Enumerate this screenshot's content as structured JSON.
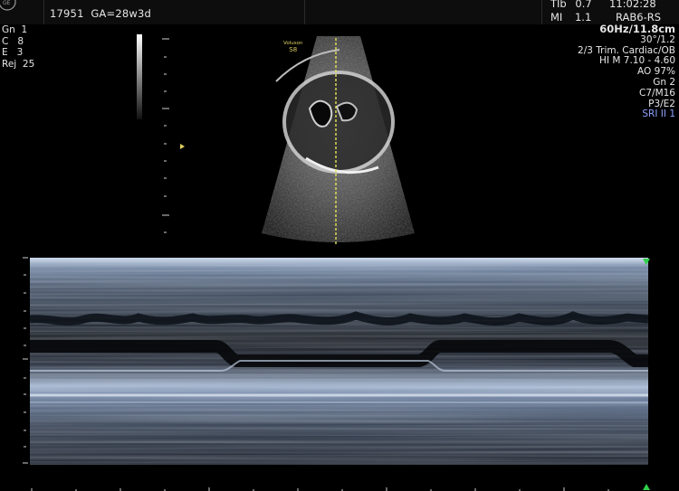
{
  "header": {
    "patient_id": "17951",
    "gestational_age": "GA=28w3d",
    "tib_label": "TIb",
    "tib_value": "0.7",
    "mi_label": "MI",
    "mi_value": "1.1",
    "time": "11:02:28",
    "probe": "RAB6-RS"
  },
  "left_params": [
    {
      "label": "Gn",
      "value": "1"
    },
    {
      "label": "C",
      "value": "8"
    },
    {
      "label": "E",
      "value": "3"
    },
    {
      "label": "Rej",
      "value": "25"
    }
  ],
  "right_params": {
    "frame_depth": "60Hz/11.8cm",
    "lines": [
      "30°/1.2",
      "2/3 Trim. Cardiac/OB",
      "HI M  7.10 - 4.60",
      "AO 97%",
      "Gn  2",
      "C7/M16",
      "P3/E2"
    ],
    "sri": "SRI II 1"
  },
  "bmode": {
    "label_top": "Voluson",
    "label_bottom": "S8"
  },
  "colors": {
    "cursor_line": "#e6e05a",
    "marker_green": "#2fd04a",
    "sri_text": "#8ea2ff",
    "accent_yellow": "#e0d060"
  },
  "icons": [
    "ge-logo-icon",
    "focus-marker-icon",
    "mmode-start-marker-icon"
  ]
}
